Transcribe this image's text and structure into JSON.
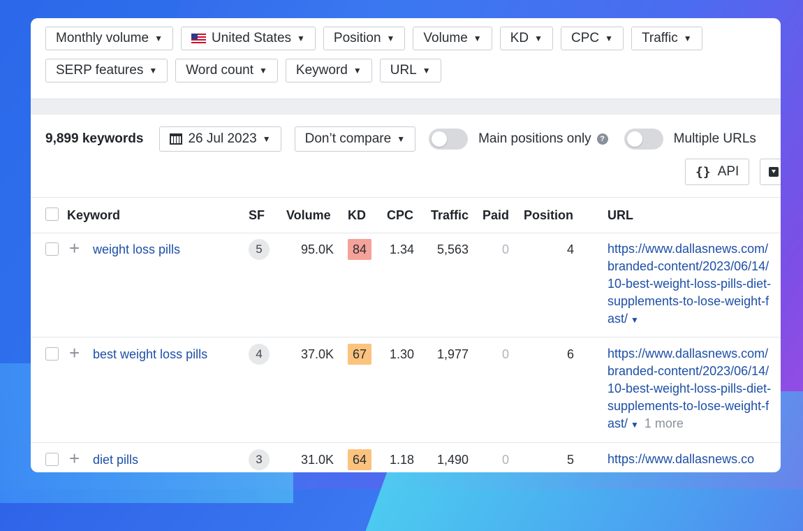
{
  "filters": {
    "row1": [
      {
        "label": "Monthly volume",
        "name": "filter-monthly-volume"
      },
      {
        "label": "United States",
        "name": "filter-country",
        "flag": true
      },
      {
        "label": "Position",
        "name": "filter-position"
      },
      {
        "label": "Volume",
        "name": "filter-volume"
      },
      {
        "label": "KD",
        "name": "filter-kd"
      },
      {
        "label": "CPC",
        "name": "filter-cpc"
      },
      {
        "label": "Traffic",
        "name": "filter-traffic"
      }
    ],
    "row2": [
      {
        "label": "SERP features",
        "name": "filter-serp-features"
      },
      {
        "label": "Word count",
        "name": "filter-word-count"
      },
      {
        "label": "Keyword",
        "name": "filter-keyword"
      },
      {
        "label": "URL",
        "name": "filter-url"
      }
    ]
  },
  "toolbar": {
    "keyword_count": "9,899 keywords",
    "date": "26 Jul 2023",
    "compare": "Don’t compare",
    "main_positions": "Main positions only",
    "multiple_urls": "Multiple URLs",
    "api": "API"
  },
  "table": {
    "headers": {
      "keyword": "Keyword",
      "sf": "SF",
      "volume": "Volume",
      "kd": "KD",
      "cpc": "CPC",
      "traffic": "Traffic",
      "paid": "Paid",
      "position": "Position",
      "url": "URL"
    },
    "rows": [
      {
        "keyword": "weight loss pills",
        "sf": "5",
        "volume": "95.0K",
        "kd": "84",
        "kd_color": "#f4a29a",
        "cpc": "1.34",
        "traffic": "5,563",
        "paid": "0",
        "position": "4",
        "url": "https://www.dallasnews.com/branded-content/2023/06/14/10-best-weight-loss-pills-diet-supplements-to-lose-weight-fast/",
        "more": ""
      },
      {
        "keyword": "best weight loss pills",
        "sf": "4",
        "volume": "37.0K",
        "kd": "67",
        "kd_color": "#fbc37e",
        "cpc": "1.30",
        "traffic": "1,977",
        "paid": "0",
        "position": "6",
        "url": "https://www.dallasnews.com/branded-content/2023/06/14/10-best-weight-loss-pills-diet-supplements-to-lose-weight-fast/",
        "more": "1 more"
      },
      {
        "keyword": "diet pills",
        "sf": "3",
        "volume": "31.0K",
        "kd": "64",
        "kd_color": "#fbc37e",
        "cpc": "1.18",
        "traffic": "1,490",
        "paid": "0",
        "position": "5",
        "url": "https://www.dallasnews.co",
        "more": ""
      }
    ]
  }
}
